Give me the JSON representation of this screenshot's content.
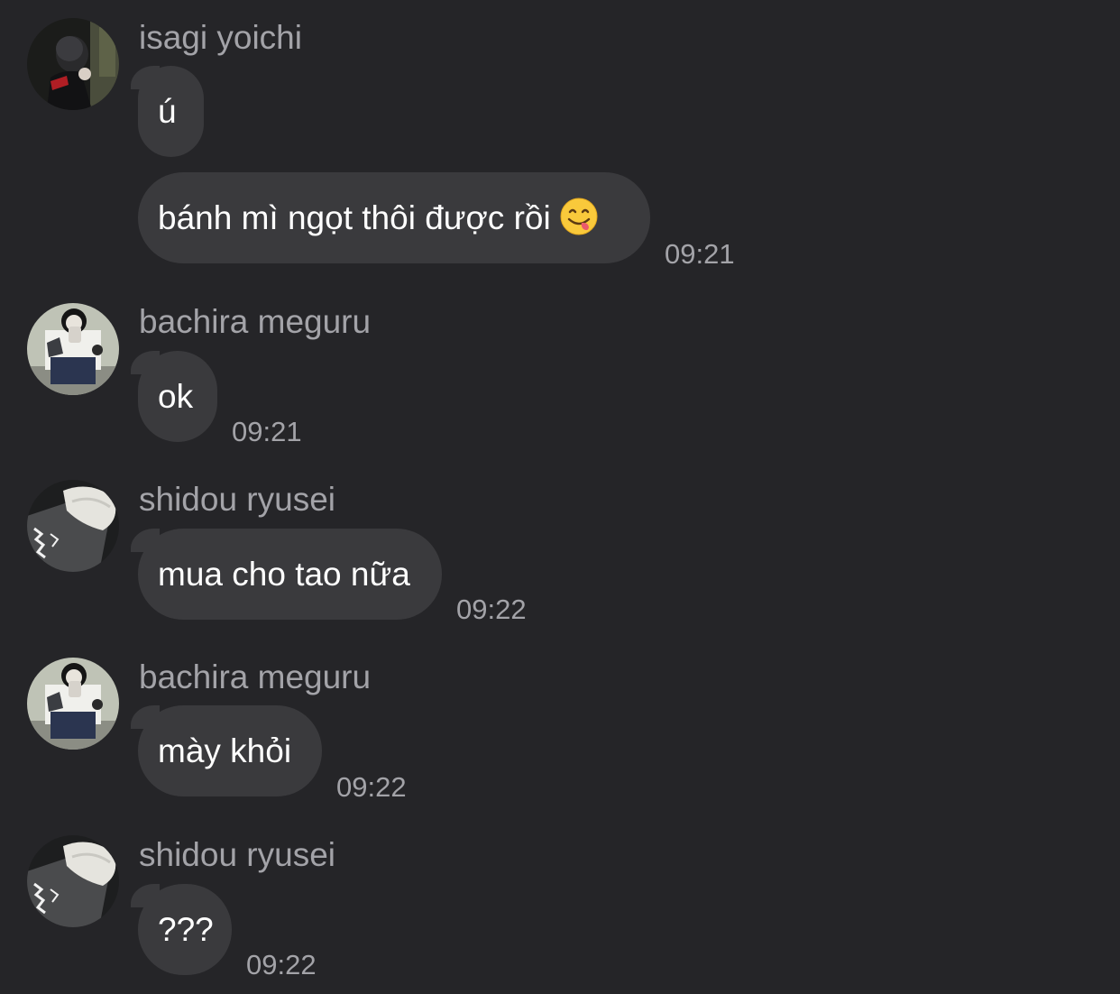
{
  "colors": {
    "background": "#252528",
    "bubble": "#3a3a3d",
    "message_text": "#ffffff",
    "meta_text": "#a3a3a8"
  },
  "messages": [
    {
      "sender": "isagi yoichi",
      "avatar": "avatar-isagi-yoichi",
      "bubbles": [
        {
          "text": "ú"
        },
        {
          "text": "bánh mì ngọt thôi được rồi",
          "emoji": "savoring-food-face-emoji",
          "time": "09:21"
        }
      ]
    },
    {
      "sender": "bachira meguru",
      "avatar": "avatar-bachira-meguru",
      "bubbles": [
        {
          "text": "ok",
          "time": "09:21"
        }
      ]
    },
    {
      "sender": "shidou ryusei",
      "avatar": "avatar-shidou-ryusei",
      "bubbles": [
        {
          "text": "mua cho tao nữa",
          "time": "09:22"
        }
      ]
    },
    {
      "sender": "bachira meguru",
      "avatar": "avatar-bachira-meguru",
      "bubbles": [
        {
          "text": "mày khỏi",
          "time": "09:22"
        }
      ]
    },
    {
      "sender": "shidou ryusei",
      "avatar": "avatar-shidou-ryusei",
      "bubbles": [
        {
          "text": "???",
          "time": "09:22"
        }
      ]
    }
  ]
}
